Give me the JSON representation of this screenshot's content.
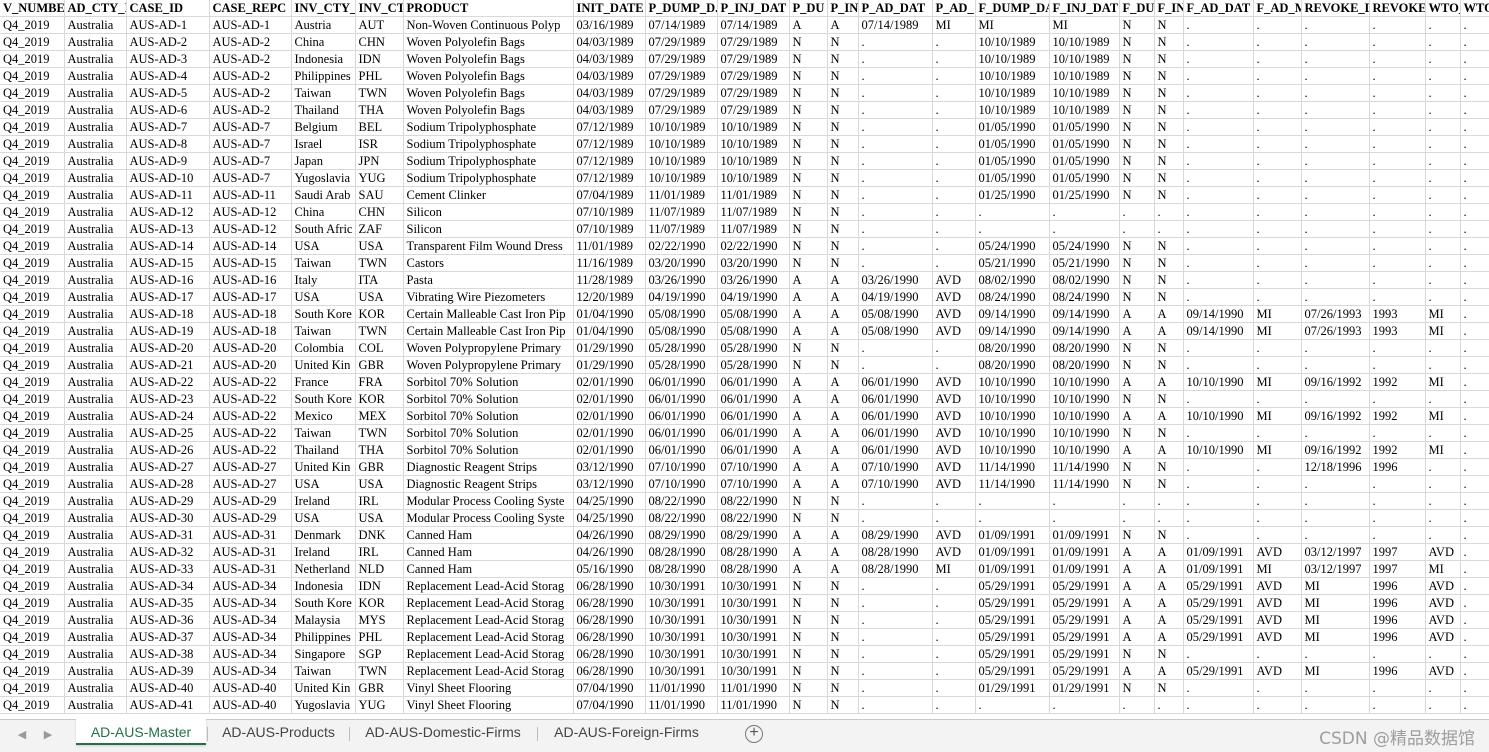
{
  "columns": [
    "V_NUMBE",
    "AD_CTY_I",
    "CASE_ID",
    "CASE_REPC",
    "INV_CTY_",
    "INV_CT",
    "PRODUCT",
    "INIT_DATE",
    "P_DUMP_D.",
    "P_INJ_DAT",
    "P_DU",
    "P_IN",
    "P_AD_DAT",
    "P_AD_",
    "F_DUMP_DA",
    "F_INJ_DAT",
    "F_DU",
    "F_IN",
    "F_AD_DAT",
    "F_AD_M",
    "REVOKE_D",
    "REVOKE",
    "WTO_",
    "WTO"
  ],
  "rows": [
    [
      "Q4_2019",
      "Australia",
      "AUS-AD-1",
      "AUS-AD-1",
      "Austria",
      "AUT",
      "Non-Woven Continuous Polyp",
      "03/16/1989",
      "07/14/1989",
      "07/14/1989",
      "A",
      "A",
      "07/14/1989",
      "MI",
      "MI",
      "MI",
      "N",
      "N",
      ".",
      ".",
      ".",
      ".",
      ".",
      "."
    ],
    [
      "Q4_2019",
      "Australia",
      "AUS-AD-2",
      "AUS-AD-2",
      "China",
      "CHN",
      "Woven Polyolefin Bags",
      "04/03/1989",
      "07/29/1989",
      "07/29/1989",
      "N",
      "N",
      ".",
      ".",
      "10/10/1989",
      "10/10/1989",
      "N",
      "N",
      ".",
      ".",
      ".",
      ".",
      ".",
      "."
    ],
    [
      "Q4_2019",
      "Australia",
      "AUS-AD-3",
      "AUS-AD-2",
      "Indonesia",
      "IDN",
      "Woven Polyolefin Bags",
      "04/03/1989",
      "07/29/1989",
      "07/29/1989",
      "N",
      "N",
      ".",
      ".",
      "10/10/1989",
      "10/10/1989",
      "N",
      "N",
      ".",
      ".",
      ".",
      ".",
      ".",
      "."
    ],
    [
      "Q4_2019",
      "Australia",
      "AUS-AD-4",
      "AUS-AD-2",
      "Philippines",
      "PHL",
      "Woven Polyolefin Bags",
      "04/03/1989",
      "07/29/1989",
      "07/29/1989",
      "N",
      "N",
      ".",
      ".",
      "10/10/1989",
      "10/10/1989",
      "N",
      "N",
      ".",
      ".",
      ".",
      ".",
      ".",
      "."
    ],
    [
      "Q4_2019",
      "Australia",
      "AUS-AD-5",
      "AUS-AD-2",
      "Taiwan",
      "TWN",
      "Woven Polyolefin Bags",
      "04/03/1989",
      "07/29/1989",
      "07/29/1989",
      "N",
      "N",
      ".",
      ".",
      "10/10/1989",
      "10/10/1989",
      "N",
      "N",
      ".",
      ".",
      ".",
      ".",
      ".",
      "."
    ],
    [
      "Q4_2019",
      "Australia",
      "AUS-AD-6",
      "AUS-AD-2",
      "Thailand",
      "THA",
      "Woven Polyolefin Bags",
      "04/03/1989",
      "07/29/1989",
      "07/29/1989",
      "N",
      "N",
      ".",
      ".",
      "10/10/1989",
      "10/10/1989",
      "N",
      "N",
      ".",
      ".",
      ".",
      ".",
      ".",
      "."
    ],
    [
      "Q4_2019",
      "Australia",
      "AUS-AD-7",
      "AUS-AD-7",
      "Belgium",
      "BEL",
      "Sodium Tripolyphosphate",
      "07/12/1989",
      "10/10/1989",
      "10/10/1989",
      "N",
      "N",
      ".",
      ".",
      "01/05/1990",
      "01/05/1990",
      "N",
      "N",
      ".",
      ".",
      ".",
      ".",
      ".",
      "."
    ],
    [
      "Q4_2019",
      "Australia",
      "AUS-AD-8",
      "AUS-AD-7",
      "Israel",
      "ISR",
      "Sodium Tripolyphosphate",
      "07/12/1989",
      "10/10/1989",
      "10/10/1989",
      "N",
      "N",
      ".",
      ".",
      "01/05/1990",
      "01/05/1990",
      "N",
      "N",
      ".",
      ".",
      ".",
      ".",
      ".",
      "."
    ],
    [
      "Q4_2019",
      "Australia",
      "AUS-AD-9",
      "AUS-AD-7",
      "Japan",
      "JPN",
      "Sodium Tripolyphosphate",
      "07/12/1989",
      "10/10/1989",
      "10/10/1989",
      "N",
      "N",
      ".",
      ".",
      "01/05/1990",
      "01/05/1990",
      "N",
      "N",
      ".",
      ".",
      ".",
      ".",
      ".",
      "."
    ],
    [
      "Q4_2019",
      "Australia",
      "AUS-AD-10",
      "AUS-AD-7",
      "Yugoslavia",
      "YUG",
      "Sodium Tripolyphosphate",
      "07/12/1989",
      "10/10/1989",
      "10/10/1989",
      "N",
      "N",
      ".",
      ".",
      "01/05/1990",
      "01/05/1990",
      "N",
      "N",
      ".",
      ".",
      ".",
      ".",
      ".",
      "."
    ],
    [
      "Q4_2019",
      "Australia",
      "AUS-AD-11",
      "AUS-AD-11",
      "Saudi Arab",
      "SAU",
      "Cement Clinker",
      "07/04/1989",
      "11/01/1989",
      "11/01/1989",
      "N",
      "N",
      ".",
      ".",
      "01/25/1990",
      "01/25/1990",
      "N",
      "N",
      ".",
      ".",
      ".",
      ".",
      ".",
      "."
    ],
    [
      "Q4_2019",
      "Australia",
      "AUS-AD-12",
      "AUS-AD-12",
      "China",
      "CHN",
      "Silicon",
      "07/10/1989",
      "11/07/1989",
      "11/07/1989",
      "N",
      "N",
      ".",
      ".",
      ".",
      ".",
      ".",
      ".",
      ".",
      ".",
      ".",
      ".",
      ".",
      "."
    ],
    [
      "Q4_2019",
      "Australia",
      "AUS-AD-13",
      "AUS-AD-12",
      "South Afric",
      "ZAF",
      "Silicon",
      "07/10/1989",
      "11/07/1989",
      "11/07/1989",
      "N",
      "N",
      ".",
      ".",
      ".",
      ".",
      ".",
      ".",
      ".",
      ".",
      ".",
      ".",
      ".",
      "."
    ],
    [
      "Q4_2019",
      "Australia",
      "AUS-AD-14",
      "AUS-AD-14",
      "USA",
      "USA",
      "Transparent Film Wound Dress",
      "11/01/1989",
      "02/22/1990",
      "02/22/1990",
      "N",
      "N",
      ".",
      ".",
      "05/24/1990",
      "05/24/1990",
      "N",
      "N",
      ".",
      ".",
      ".",
      ".",
      ".",
      "."
    ],
    [
      "Q4_2019",
      "Australia",
      "AUS-AD-15",
      "AUS-AD-15",
      "Taiwan",
      "TWN",
      "Castors",
      "11/16/1989",
      "03/20/1990",
      "03/20/1990",
      "N",
      "N",
      ".",
      ".",
      "05/21/1990",
      "05/21/1990",
      "N",
      "N",
      ".",
      ".",
      ".",
      ".",
      ".",
      "."
    ],
    [
      "Q4_2019",
      "Australia",
      "AUS-AD-16",
      "AUS-AD-16",
      "Italy",
      "ITA",
      "Pasta",
      "11/28/1989",
      "03/26/1990",
      "03/26/1990",
      "A",
      "A",
      "03/26/1990",
      "AVD",
      "08/02/1990",
      "08/02/1990",
      "N",
      "N",
      ".",
      ".",
      ".",
      ".",
      ".",
      "."
    ],
    [
      "Q4_2019",
      "Australia",
      "AUS-AD-17",
      "AUS-AD-17",
      "USA",
      "USA",
      "Vibrating Wire Piezometers",
      "12/20/1989",
      "04/19/1990",
      "04/19/1990",
      "A",
      "A",
      "04/19/1990",
      "AVD",
      "08/24/1990",
      "08/24/1990",
      "N",
      "N",
      ".",
      ".",
      ".",
      ".",
      ".",
      "."
    ],
    [
      "Q4_2019",
      "Australia",
      "AUS-AD-18",
      "AUS-AD-18",
      "South Kore",
      "KOR",
      "Certain Malleable Cast Iron Pip",
      "01/04/1990",
      "05/08/1990",
      "05/08/1990",
      "A",
      "A",
      "05/08/1990",
      "AVD",
      "09/14/1990",
      "09/14/1990",
      "A",
      "A",
      "09/14/1990",
      "MI",
      "07/26/1993",
      "1993",
      "MI",
      "."
    ],
    [
      "Q4_2019",
      "Australia",
      "AUS-AD-19",
      "AUS-AD-18",
      "Taiwan",
      "TWN",
      "Certain Malleable Cast Iron Pip",
      "01/04/1990",
      "05/08/1990",
      "05/08/1990",
      "A",
      "A",
      "05/08/1990",
      "AVD",
      "09/14/1990",
      "09/14/1990",
      "A",
      "A",
      "09/14/1990",
      "MI",
      "07/26/1993",
      "1993",
      "MI",
      "."
    ],
    [
      "Q4_2019",
      "Australia",
      "AUS-AD-20",
      "AUS-AD-20",
      "Colombia",
      "COL",
      "Woven Polypropylene Primary",
      "01/29/1990",
      "05/28/1990",
      "05/28/1990",
      "N",
      "N",
      ".",
      ".",
      "08/20/1990",
      "08/20/1990",
      "N",
      "N",
      ".",
      ".",
      ".",
      ".",
      ".",
      "."
    ],
    [
      "Q4_2019",
      "Australia",
      "AUS-AD-21",
      "AUS-AD-20",
      "United Kin",
      "GBR",
      "Woven Polypropylene Primary",
      "01/29/1990",
      "05/28/1990",
      "05/28/1990",
      "N",
      "N",
      ".",
      ".",
      "08/20/1990",
      "08/20/1990",
      "N",
      "N",
      ".",
      ".",
      ".",
      ".",
      ".",
      "."
    ],
    [
      "Q4_2019",
      "Australia",
      "AUS-AD-22",
      "AUS-AD-22",
      "France",
      "FRA",
      "Sorbitol 70% Solution",
      "02/01/1990",
      "06/01/1990",
      "06/01/1990",
      "A",
      "A",
      "06/01/1990",
      "AVD",
      "10/10/1990",
      "10/10/1990",
      "A",
      "A",
      "10/10/1990",
      "MI",
      "09/16/1992",
      "1992",
      "MI",
      "."
    ],
    [
      "Q4_2019",
      "Australia",
      "AUS-AD-23",
      "AUS-AD-22",
      "South Kore",
      "KOR",
      "Sorbitol 70% Solution",
      "02/01/1990",
      "06/01/1990",
      "06/01/1990",
      "A",
      "A",
      "06/01/1990",
      "AVD",
      "10/10/1990",
      "10/10/1990",
      "N",
      "N",
      ".",
      ".",
      ".",
      ".",
      ".",
      "."
    ],
    [
      "Q4_2019",
      "Australia",
      "AUS-AD-24",
      "AUS-AD-22",
      "Mexico",
      "MEX",
      "Sorbitol 70% Solution",
      "02/01/1990",
      "06/01/1990",
      "06/01/1990",
      "A",
      "A",
      "06/01/1990",
      "AVD",
      "10/10/1990",
      "10/10/1990",
      "A",
      "A",
      "10/10/1990",
      "MI",
      "09/16/1992",
      "1992",
      "MI",
      "."
    ],
    [
      "Q4_2019",
      "Australia",
      "AUS-AD-25",
      "AUS-AD-22",
      "Taiwan",
      "TWN",
      "Sorbitol 70% Solution",
      "02/01/1990",
      "06/01/1990",
      "06/01/1990",
      "A",
      "A",
      "06/01/1990",
      "AVD",
      "10/10/1990",
      "10/10/1990",
      "N",
      "N",
      ".",
      ".",
      ".",
      ".",
      ".",
      "."
    ],
    [
      "Q4_2019",
      "Australia",
      "AUS-AD-26",
      "AUS-AD-22",
      "Thailand",
      "THA",
      "Sorbitol 70% Solution",
      "02/01/1990",
      "06/01/1990",
      "06/01/1990",
      "A",
      "A",
      "06/01/1990",
      "AVD",
      "10/10/1990",
      "10/10/1990",
      "A",
      "A",
      "10/10/1990",
      "MI",
      "09/16/1992",
      "1992",
      "MI",
      "."
    ],
    [
      "Q4_2019",
      "Australia",
      "AUS-AD-27",
      "AUS-AD-27",
      "United Kin",
      "GBR",
      "Diagnostic Reagent Strips",
      "03/12/1990",
      "07/10/1990",
      "07/10/1990",
      "A",
      "A",
      "07/10/1990",
      "AVD",
      "11/14/1990",
      "11/14/1990",
      "N",
      "N",
      ".",
      ".",
      "12/18/1996",
      "1996",
      ".",
      "."
    ],
    [
      "Q4_2019",
      "Australia",
      "AUS-AD-28",
      "AUS-AD-27",
      "USA",
      "USA",
      "Diagnostic Reagent Strips",
      "03/12/1990",
      "07/10/1990",
      "07/10/1990",
      "A",
      "A",
      "07/10/1990",
      "AVD",
      "11/14/1990",
      "11/14/1990",
      "N",
      "N",
      ".",
      ".",
      ".",
      ".",
      ".",
      "."
    ],
    [
      "Q4_2019",
      "Australia",
      "AUS-AD-29",
      "AUS-AD-29",
      "Ireland",
      "IRL",
      "Modular Process Cooling Syste",
      "04/25/1990",
      "08/22/1990",
      "08/22/1990",
      "N",
      "N",
      ".",
      ".",
      ".",
      ".",
      ".",
      ".",
      ".",
      ".",
      ".",
      ".",
      ".",
      "."
    ],
    [
      "Q4_2019",
      "Australia",
      "AUS-AD-30",
      "AUS-AD-29",
      "USA",
      "USA",
      "Modular Process Cooling Syste",
      "04/25/1990",
      "08/22/1990",
      "08/22/1990",
      "N",
      "N",
      ".",
      ".",
      ".",
      ".",
      ".",
      ".",
      ".",
      ".",
      ".",
      ".",
      ".",
      "."
    ],
    [
      "Q4_2019",
      "Australia",
      "AUS-AD-31",
      "AUS-AD-31",
      "Denmark",
      "DNK",
      "Canned Ham",
      "04/26/1990",
      "08/29/1990",
      "08/29/1990",
      "A",
      "A",
      "08/29/1990",
      "AVD",
      "01/09/1991",
      "01/09/1991",
      "N",
      "N",
      ".",
      ".",
      ".",
      ".",
      ".",
      "."
    ],
    [
      "Q4_2019",
      "Australia",
      "AUS-AD-32",
      "AUS-AD-31",
      "Ireland",
      "IRL",
      "Canned Ham",
      "04/26/1990",
      "08/28/1990",
      "08/28/1990",
      "A",
      "A",
      "08/28/1990",
      "AVD",
      "01/09/1991",
      "01/09/1991",
      "A",
      "A",
      "01/09/1991",
      "AVD",
      "03/12/1997",
      "1997",
      "AVD",
      "."
    ],
    [
      "Q4_2019",
      "Australia",
      "AUS-AD-33",
      "AUS-AD-31",
      "Netherland",
      "NLD",
      "Canned Ham",
      "05/16/1990",
      "08/28/1990",
      "08/28/1990",
      "A",
      "A",
      "08/28/1990",
      "MI",
      "01/09/1991",
      "01/09/1991",
      "A",
      "A",
      "01/09/1991",
      "MI",
      "03/12/1997",
      "1997",
      "MI",
      "."
    ],
    [
      "Q4_2019",
      "Australia",
      "AUS-AD-34",
      "AUS-AD-34",
      "Indonesia",
      "IDN",
      "Replacement Lead-Acid Storag",
      "06/28/1990",
      "10/30/1991",
      "10/30/1991",
      "N",
      "N",
      ".",
      ".",
      "05/29/1991",
      "05/29/1991",
      "A",
      "A",
      "05/29/1991",
      "AVD",
      "MI",
      "1996",
      "AVD",
      "."
    ],
    [
      "Q4_2019",
      "Australia",
      "AUS-AD-35",
      "AUS-AD-34",
      "South Kore",
      "KOR",
      "Replacement Lead-Acid Storag",
      "06/28/1990",
      "10/30/1991",
      "10/30/1991",
      "N",
      "N",
      ".",
      ".",
      "05/29/1991",
      "05/29/1991",
      "A",
      "A",
      "05/29/1991",
      "AVD",
      "MI",
      "1996",
      "AVD",
      "."
    ],
    [
      "Q4_2019",
      "Australia",
      "AUS-AD-36",
      "AUS-AD-34",
      "Malaysia",
      "MYS",
      "Replacement Lead-Acid Storag",
      "06/28/1990",
      "10/30/1991",
      "10/30/1991",
      "N",
      "N",
      ".",
      ".",
      "05/29/1991",
      "05/29/1991",
      "A",
      "A",
      "05/29/1991",
      "AVD",
      "MI",
      "1996",
      "AVD",
      "."
    ],
    [
      "Q4_2019",
      "Australia",
      "AUS-AD-37",
      "AUS-AD-34",
      "Philippines",
      "PHL",
      "Replacement Lead-Acid Storag",
      "06/28/1990",
      "10/30/1991",
      "10/30/1991",
      "N",
      "N",
      ".",
      ".",
      "05/29/1991",
      "05/29/1991",
      "A",
      "A",
      "05/29/1991",
      "AVD",
      "MI",
      "1996",
      "AVD",
      "."
    ],
    [
      "Q4_2019",
      "Australia",
      "AUS-AD-38",
      "AUS-AD-34",
      "Singapore",
      "SGP",
      "Replacement Lead-Acid Storag",
      "06/28/1990",
      "10/30/1991",
      "10/30/1991",
      "N",
      "N",
      ".",
      ".",
      "05/29/1991",
      "05/29/1991",
      "N",
      "N",
      ".",
      ".",
      ".",
      ".",
      ".",
      "."
    ],
    [
      "Q4_2019",
      "Australia",
      "AUS-AD-39",
      "AUS-AD-34",
      "Taiwan",
      "TWN",
      "Replacement Lead-Acid Storag",
      "06/28/1990",
      "10/30/1991",
      "10/30/1991",
      "N",
      "N",
      ".",
      ".",
      "05/29/1991",
      "05/29/1991",
      "A",
      "A",
      "05/29/1991",
      "AVD",
      "MI",
      "1996",
      "AVD",
      "."
    ],
    [
      "Q4_2019",
      "Australia",
      "AUS-AD-40",
      "AUS-AD-40",
      "United Kin",
      "GBR",
      "Vinyl Sheet Flooring",
      "07/04/1990",
      "11/01/1990",
      "11/01/1990",
      "N",
      "N",
      ".",
      ".",
      "01/29/1991",
      "01/29/1991",
      "N",
      "N",
      ".",
      ".",
      ".",
      ".",
      ".",
      "."
    ],
    [
      "Q4_2019",
      "Australia",
      "AUS-AD-41",
      "AUS-AD-40",
      "Yugoslavia",
      "YUG",
      "Vinyl Sheet Flooring",
      "07/04/1990",
      "11/01/1990",
      "11/01/1990",
      "N",
      "N",
      ".",
      ".",
      ".",
      ".",
      ".",
      ".",
      ".",
      ".",
      ".",
      ".",
      ".",
      "."
    ]
  ],
  "sheet_tabs": [
    {
      "label": "AD-AUS-Master",
      "active": true
    },
    {
      "label": "AD-AUS-Products",
      "active": false
    },
    {
      "label": "AD-AUS-Domestic-Firms",
      "active": false
    },
    {
      "label": "AD-AUS-Foreign-Firms",
      "active": false
    }
  ],
  "icons": {
    "nav_prev": "triangle-left-icon",
    "nav_next": "triangle-right-icon",
    "add_sheet": "plus-circle-icon"
  },
  "accent_color": "#217346",
  "watermark": "CSDN @精品数据馆"
}
